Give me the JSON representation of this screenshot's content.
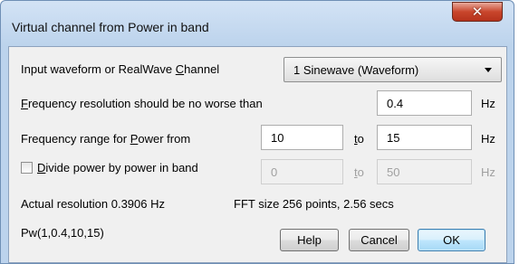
{
  "window": {
    "title": "Virtual channel from Power in band",
    "close_glyph": "✕"
  },
  "input": {
    "label_pre": "Input waveform or RealWave ",
    "label_key": "C",
    "label_post": "hannel",
    "selected": "1 Sinewave (Waveform)"
  },
  "resolution": {
    "label_key": "F",
    "label_post": "requency resolution should be no worse than",
    "value": "0.4",
    "unit": "Hz"
  },
  "range": {
    "label_pre": "Frequency range for ",
    "label_key": "P",
    "label_post": "ower from",
    "from": "10",
    "to_key": "t",
    "to_post": "o",
    "to": "15",
    "unit": "Hz"
  },
  "divide": {
    "label_key": "D",
    "label_post": "ivide power by power in band",
    "from": "0",
    "to_key": "t",
    "to_post": "o",
    "to": "50",
    "unit": "Hz",
    "checked": false
  },
  "info": {
    "actual_resolution": "Actual resolution  0.3906 Hz",
    "fft_size": "FFT size  256 points, 2.56 secs",
    "expression": "Pw(1,0.4,10,15)"
  },
  "buttons": {
    "help": "Help",
    "cancel": "Cancel",
    "ok": "OK"
  }
}
